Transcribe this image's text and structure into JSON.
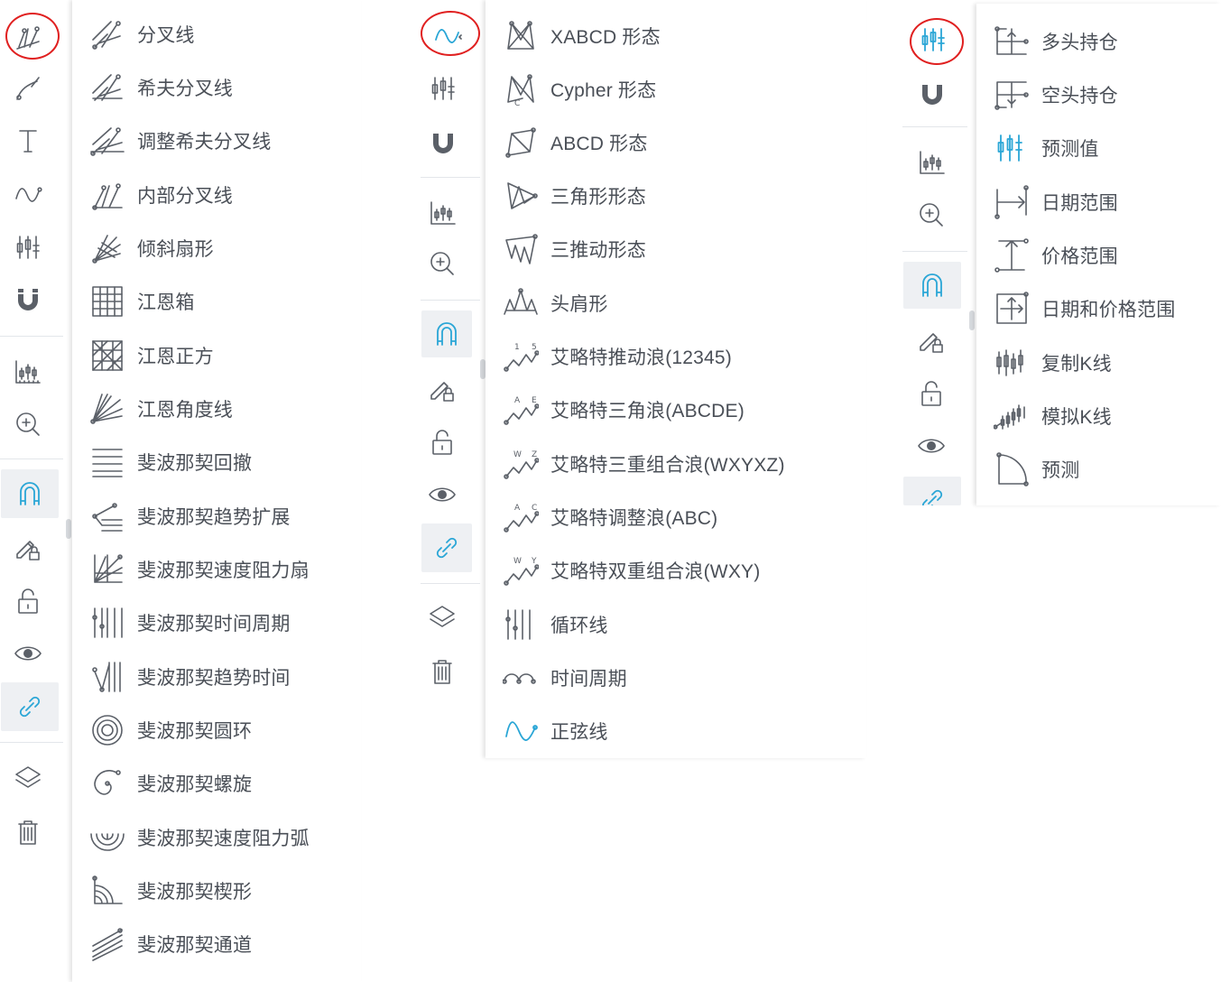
{
  "colors": {
    "accent": "#2aa6d6",
    "highlight_circle": "#e02020",
    "icon": "#5b6068",
    "text": "#4a4f57",
    "active_bg": "#eef0f3"
  },
  "panel1": {
    "toolbar_icons": [
      "pitchfork-icon",
      "brush-icon",
      "text-icon",
      "wave-icon",
      "position-icon",
      "magnet-icon",
      "measure-icon",
      "zoom-in-icon",
      "magnet-arch-icon",
      "pencil-lock-icon",
      "unlock-icon",
      "eye-icon",
      "link-icon",
      "layers-icon",
      "trash-icon"
    ],
    "items": [
      {
        "label": "分叉线",
        "icon": "pitchfork-icon"
      },
      {
        "label": "希夫分叉线",
        "icon": "schiff-pitchfork-icon"
      },
      {
        "label": "调整希夫分叉线",
        "icon": "modified-schiff-pitchfork-icon"
      },
      {
        "label": "内部分叉线",
        "icon": "inside-pitchfork-icon"
      },
      {
        "label": "倾斜扇形",
        "icon": "pitchfan-icon"
      },
      {
        "label": "江恩箱",
        "icon": "gann-box-icon"
      },
      {
        "label": "江恩正方",
        "icon": "gann-square-icon"
      },
      {
        "label": "江恩角度线",
        "icon": "gann-fan-icon"
      },
      {
        "label": "斐波那契回撤",
        "icon": "fib-retracement-icon"
      },
      {
        "label": "斐波那契趋势扩展",
        "icon": "fib-extension-icon"
      },
      {
        "label": "斐波那契速度阻力扇",
        "icon": "fib-speed-fan-icon"
      },
      {
        "label": "斐波那契时间周期",
        "icon": "fib-time-zone-icon"
      },
      {
        "label": "斐波那契趋势时间",
        "icon": "fib-trend-time-icon"
      },
      {
        "label": "斐波那契圆环",
        "icon": "fib-circles-icon"
      },
      {
        "label": "斐波那契螺旋",
        "icon": "fib-spiral-icon"
      },
      {
        "label": "斐波那契速度阻力弧",
        "icon": "fib-speed-arcs-icon"
      },
      {
        "label": "斐波那契楔形",
        "icon": "fib-wedge-icon"
      },
      {
        "label": "斐波那契通道",
        "icon": "fib-channel-icon"
      }
    ]
  },
  "panel2": {
    "toolbar_icons": [
      "wave-icon",
      "position-icon",
      "magnet-icon",
      "measure-icon",
      "zoom-in-icon",
      "magnet-arch-icon",
      "pencil-lock-icon",
      "unlock-icon",
      "eye-icon",
      "link-icon",
      "layers-icon",
      "trash-icon"
    ],
    "items": [
      {
        "label": "XABCD 形态",
        "icon": "xabcd-pattern-icon"
      },
      {
        "label": "Cypher 形态",
        "icon": "cypher-pattern-icon"
      },
      {
        "label": "ABCD 形态",
        "icon": "abcd-pattern-icon"
      },
      {
        "label": "三角形形态",
        "icon": "triangle-pattern-icon"
      },
      {
        "label": "三推动形态",
        "icon": "three-drives-icon"
      },
      {
        "label": "头肩形",
        "icon": "head-shoulders-icon"
      },
      {
        "label": "艾略特推动浪(12345)",
        "icon": "elliott-impulse-icon",
        "tag": [
          "1",
          "5"
        ]
      },
      {
        "label": "艾略特三角浪(ABCDE)",
        "icon": "elliott-triangle-icon",
        "tag": [
          "A",
          "E"
        ]
      },
      {
        "label": "艾略特三重组合浪(WXYXZ)",
        "icon": "elliott-triple-combo-icon",
        "tag": [
          "W",
          "Z"
        ]
      },
      {
        "label": "艾略特调整浪(ABC)",
        "icon": "elliott-correction-icon",
        "tag": [
          "A",
          "C"
        ]
      },
      {
        "label": "艾略特双重组合浪(WXY)",
        "icon": "elliott-double-combo-icon",
        "tag": [
          "W",
          "Y"
        ]
      },
      {
        "label": "循环线",
        "icon": "cyclic-lines-icon"
      },
      {
        "label": "时间周期",
        "icon": "time-cycles-icon"
      },
      {
        "label": "正弦线",
        "icon": "sine-line-icon"
      }
    ]
  },
  "panel3": {
    "toolbar_icons": [
      "position-icon",
      "magnet-icon",
      "measure-icon",
      "zoom-in-icon",
      "magnet-arch-icon",
      "pencil-lock-icon",
      "unlock-icon",
      "eye-icon",
      "link-icon"
    ],
    "items": [
      {
        "label": "多头持仓",
        "icon": "long-position-icon"
      },
      {
        "label": "空头持仓",
        "icon": "short-position-icon"
      },
      {
        "label": "预测值",
        "icon": "forecast-icon"
      },
      {
        "label": "日期范围",
        "icon": "date-range-icon"
      },
      {
        "label": "价格范围",
        "icon": "price-range-icon"
      },
      {
        "label": "日期和价格范围",
        "icon": "date-price-range-icon"
      },
      {
        "label": "复制K线",
        "icon": "bars-pattern-icon"
      },
      {
        "label": "模拟K线",
        "icon": "ghost-feed-icon"
      },
      {
        "label": "预测",
        "icon": "projection-icon"
      }
    ]
  }
}
